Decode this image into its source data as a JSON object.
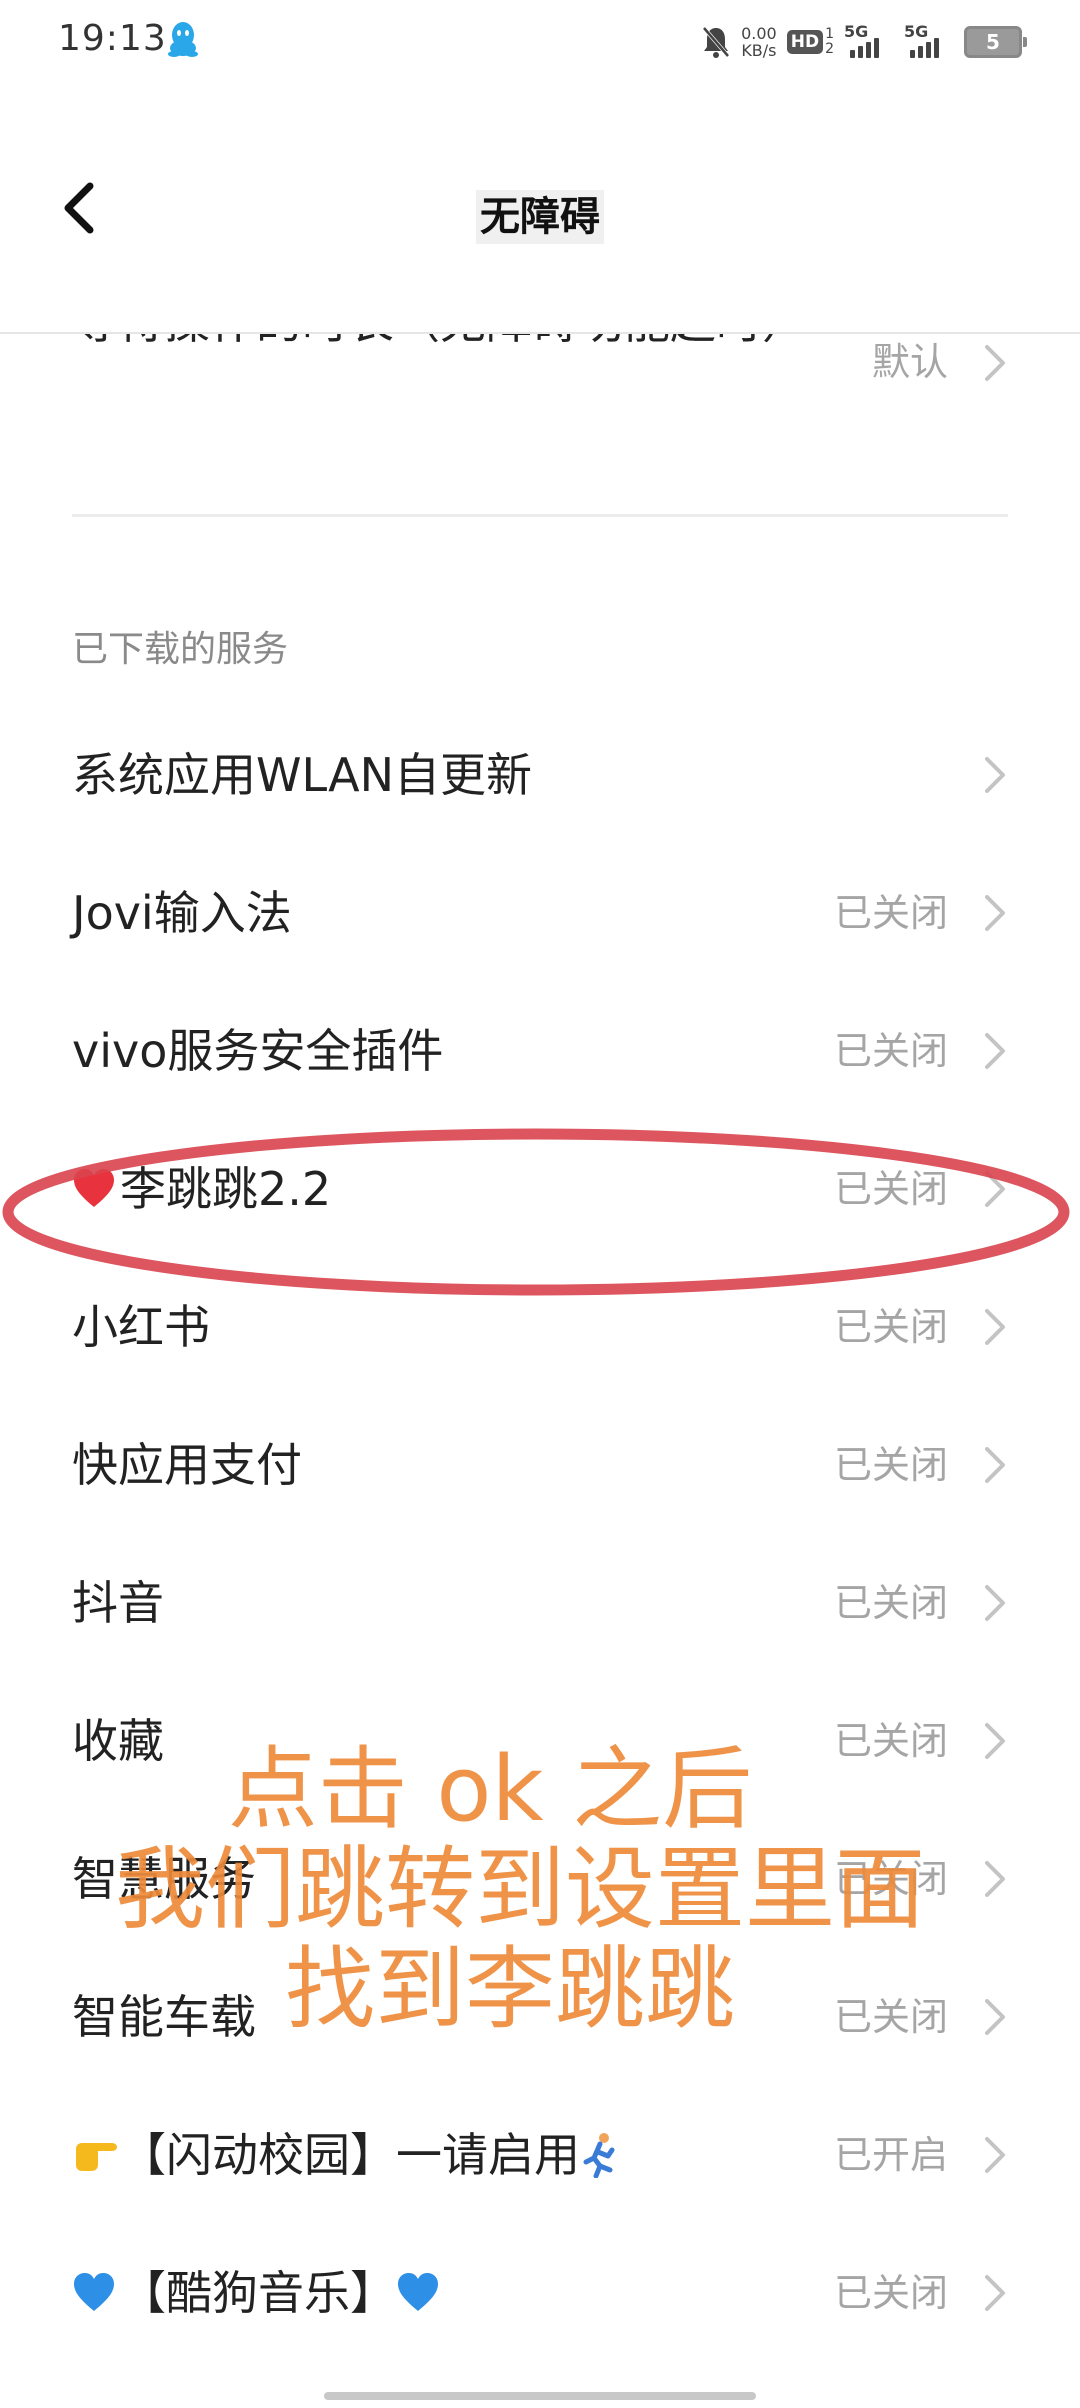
{
  "status_bar": {
    "time": "19:13",
    "net_speed_value": "0.00",
    "net_speed_unit": "KB/s",
    "hd_label": "HD",
    "hd_sub_top": "1",
    "hd_sub_bottom": "2",
    "signal1_label": "5G",
    "signal2_label": "5G",
    "battery_level": "5"
  },
  "header": {
    "title": "无障碍"
  },
  "top_item": {
    "label": "等待操作的时长（无障碍功能超时）",
    "status": "默认"
  },
  "section": {
    "label": "已下载的服务"
  },
  "services": [
    {
      "label": "系统应用WLAN自更新",
      "status": ""
    },
    {
      "label": "Jovi输入法",
      "status": "已关闭"
    },
    {
      "label": "vivo服务安全插件",
      "status": "已关闭"
    },
    {
      "label": "李跳跳2.2",
      "status": "已关闭"
    },
    {
      "label": "小红书",
      "status": "已关闭"
    },
    {
      "label": "快应用支付",
      "status": "已关闭"
    },
    {
      "label": "抖音",
      "status": "已关闭"
    },
    {
      "label": "收藏",
      "status": "已关闭"
    },
    {
      "label": "智慧服务",
      "status": "已关闭"
    },
    {
      "label": "智能车载",
      "status": "已关闭"
    },
    {
      "label": "【闪动校园】一请启用",
      "status": "已开启"
    },
    {
      "label": "【酷狗音乐】",
      "status": "已关闭"
    }
  ],
  "annotation": {
    "line1": "点击 ok 之后",
    "line2": "我们跳转到设置里面",
    "line3": "找到李跳跳"
  },
  "colors": {
    "annotation_ellipse": "#d9444e",
    "annotation_text": "#ee8a3a",
    "status_text": "#a5a5a5",
    "heart": "#e8333f",
    "blue_heart": "#2e8fe6"
  }
}
